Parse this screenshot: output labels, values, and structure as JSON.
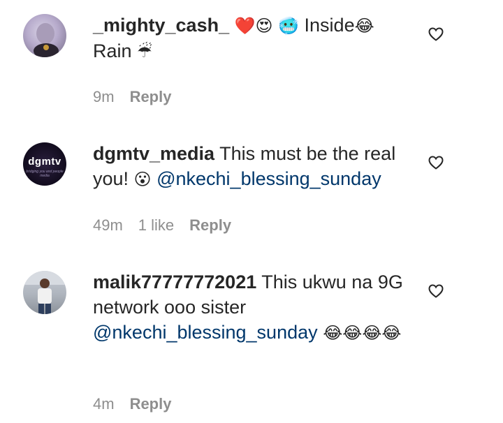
{
  "comments": [
    {
      "username": "_mighty_cash_",
      "line1_pre": " ",
      "emojis_a": "❤️😍 🥶",
      "line1_post": " Inside",
      "emojis_b": "😂",
      "line2": "Rain ",
      "emojis_c": "☔",
      "time": "9m",
      "reply": "Reply"
    },
    {
      "username": "dgmtv_media",
      "avatar_text": "dgmtv",
      "avatar_sub": "bridging you and people media",
      "body_pre": " This must be the real you! ",
      "emoji": "😮",
      "mention": "@nkechi_blessing_sunday",
      "time": "49m",
      "likes": "1 like",
      "reply": "Reply"
    },
    {
      "username": "malik77777772021",
      "body_pre": " This ukwu na 9G network ooo sister ",
      "mention": "@nkechi_blessing_sunday",
      "emojis": " 😂😂😂😂",
      "time": "4m",
      "reply": "Reply"
    }
  ]
}
